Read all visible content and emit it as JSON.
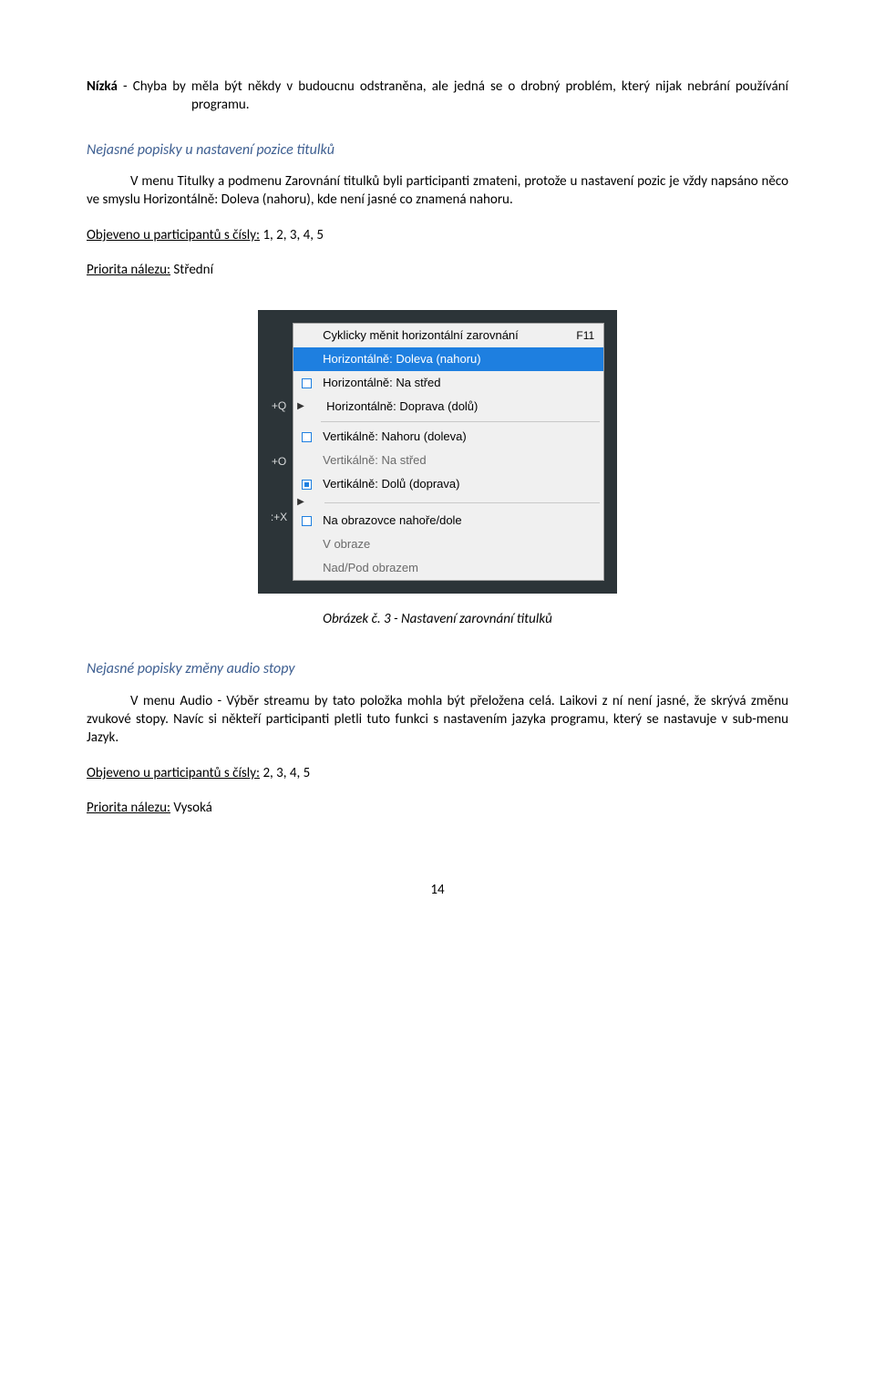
{
  "definition": {
    "lead": "Nízká",
    "text": " - Chyba by měla být někdy v budoucnu odstraněna, ale jedná se o drobný problém, který nijak nebrání používání programu."
  },
  "section1": {
    "heading": "Nejasné popisky u nastavení pozice titulků",
    "p1": "V menu Titulky a podmenu Zarovnání titulků byli participanti zmateni, protože u nastavení pozic je vždy napsáno něco ve smyslu Horizontálně: Doleva (nahoru), kde není jasné co znamená nahoru.",
    "found_label": "Objeveno u participantů s čísly:",
    "found_value": " 1, 2, 3, 4, 5",
    "prio_label": "Priorita nálezu:",
    "prio_value": " Střední"
  },
  "shortcuts": {
    "q": "+Q",
    "o": "+O",
    "x": ":+X"
  },
  "menu": {
    "items": [
      {
        "type": "item",
        "label": "Cyklicky měnit horizontální zarovnání",
        "accel": "F11"
      },
      {
        "type": "sel",
        "label": "Horizontálně: Doleva (nahoru)"
      },
      {
        "type": "radio",
        "label": "Horizontálně: Na střed"
      },
      {
        "type": "arrow_item",
        "label": "Horizontálně: Doprava (dolů)"
      },
      {
        "type": "sep"
      },
      {
        "type": "radio",
        "label": "Vertikálně: Nahoru (doleva)"
      },
      {
        "type": "dim",
        "label": "Vertikálně: Na střed"
      },
      {
        "type": "radio_filled",
        "label": "Vertikálně: Dolů (doprava)"
      },
      {
        "type": "arrow_sep"
      },
      {
        "type": "radio",
        "label": "Na obrazovce nahoře/dole"
      },
      {
        "type": "dim",
        "label": "V obraze"
      },
      {
        "type": "dim",
        "label": "Nad/Pod obrazem"
      }
    ]
  },
  "caption": "Obrázek č. 3 - Nastavení zarovnání titulků",
  "section2": {
    "heading": "Nejasné popisky změny audio stopy",
    "p1": "V menu Audio - Výběr streamu by tato položka mohla být přeložena celá. Laikovi z ní není jasné, že skrývá změnu zvukové stopy. Navíc si někteří participanti pletli tuto funkci s nastavením jazyka programu, který se nastavuje v sub-menu Jazyk.",
    "found_label": "Objeveno u participantů s čísly:",
    "found_value": " 2, 3, 4, 5",
    "prio_label": "Priorita nálezu:",
    "prio_value": " Vysoká"
  },
  "page": "14"
}
